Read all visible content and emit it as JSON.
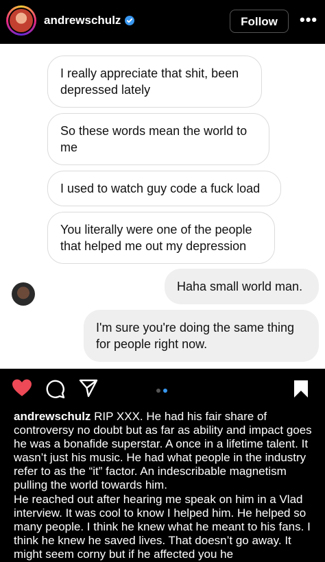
{
  "header": {
    "username": "andrewschulz",
    "follow_label": "Follow",
    "more_label": "•••"
  },
  "messages": [
    {
      "direction": "in",
      "text": "I really appreciate that shit, been depressed lately"
    },
    {
      "direction": "in",
      "text": "So these words mean the world to me"
    },
    {
      "direction": "in",
      "text": "I used to watch guy code a fuck load"
    },
    {
      "direction": "in",
      "text": "You literally were one of the people that helped me out my depression"
    },
    {
      "direction": "out",
      "text": "Haha small world man."
    },
    {
      "direction": "out",
      "text": "I'm sure you're doing the same thing for people right now."
    }
  ],
  "post": {
    "liked": true,
    "carousel": {
      "count": 2,
      "active": 2
    },
    "colors": {
      "like": "#ed4956",
      "dot_active": "#3897f0",
      "dot_inactive": "#555555"
    },
    "caption_user": "andrewschulz",
    "caption_text": " RIP XXX. He had his fair share of controversy no doubt but as far as ability and impact goes he was a bonafide superstar. A once in a lifetime talent. It wasn’t just his music. He had what people in the industry refer to as the “it” factor. An indescribable magnetism pulling the world towards him.",
    "caption_text_2": "He reached out after hearing me speak on him in a Vlad interview. It was cool to know I helped him. He helped so many people. I think he knew what he meant to his fans. I think he knew he saved lives. That doesn’t go away. It might seem corny but if he affected you he"
  }
}
